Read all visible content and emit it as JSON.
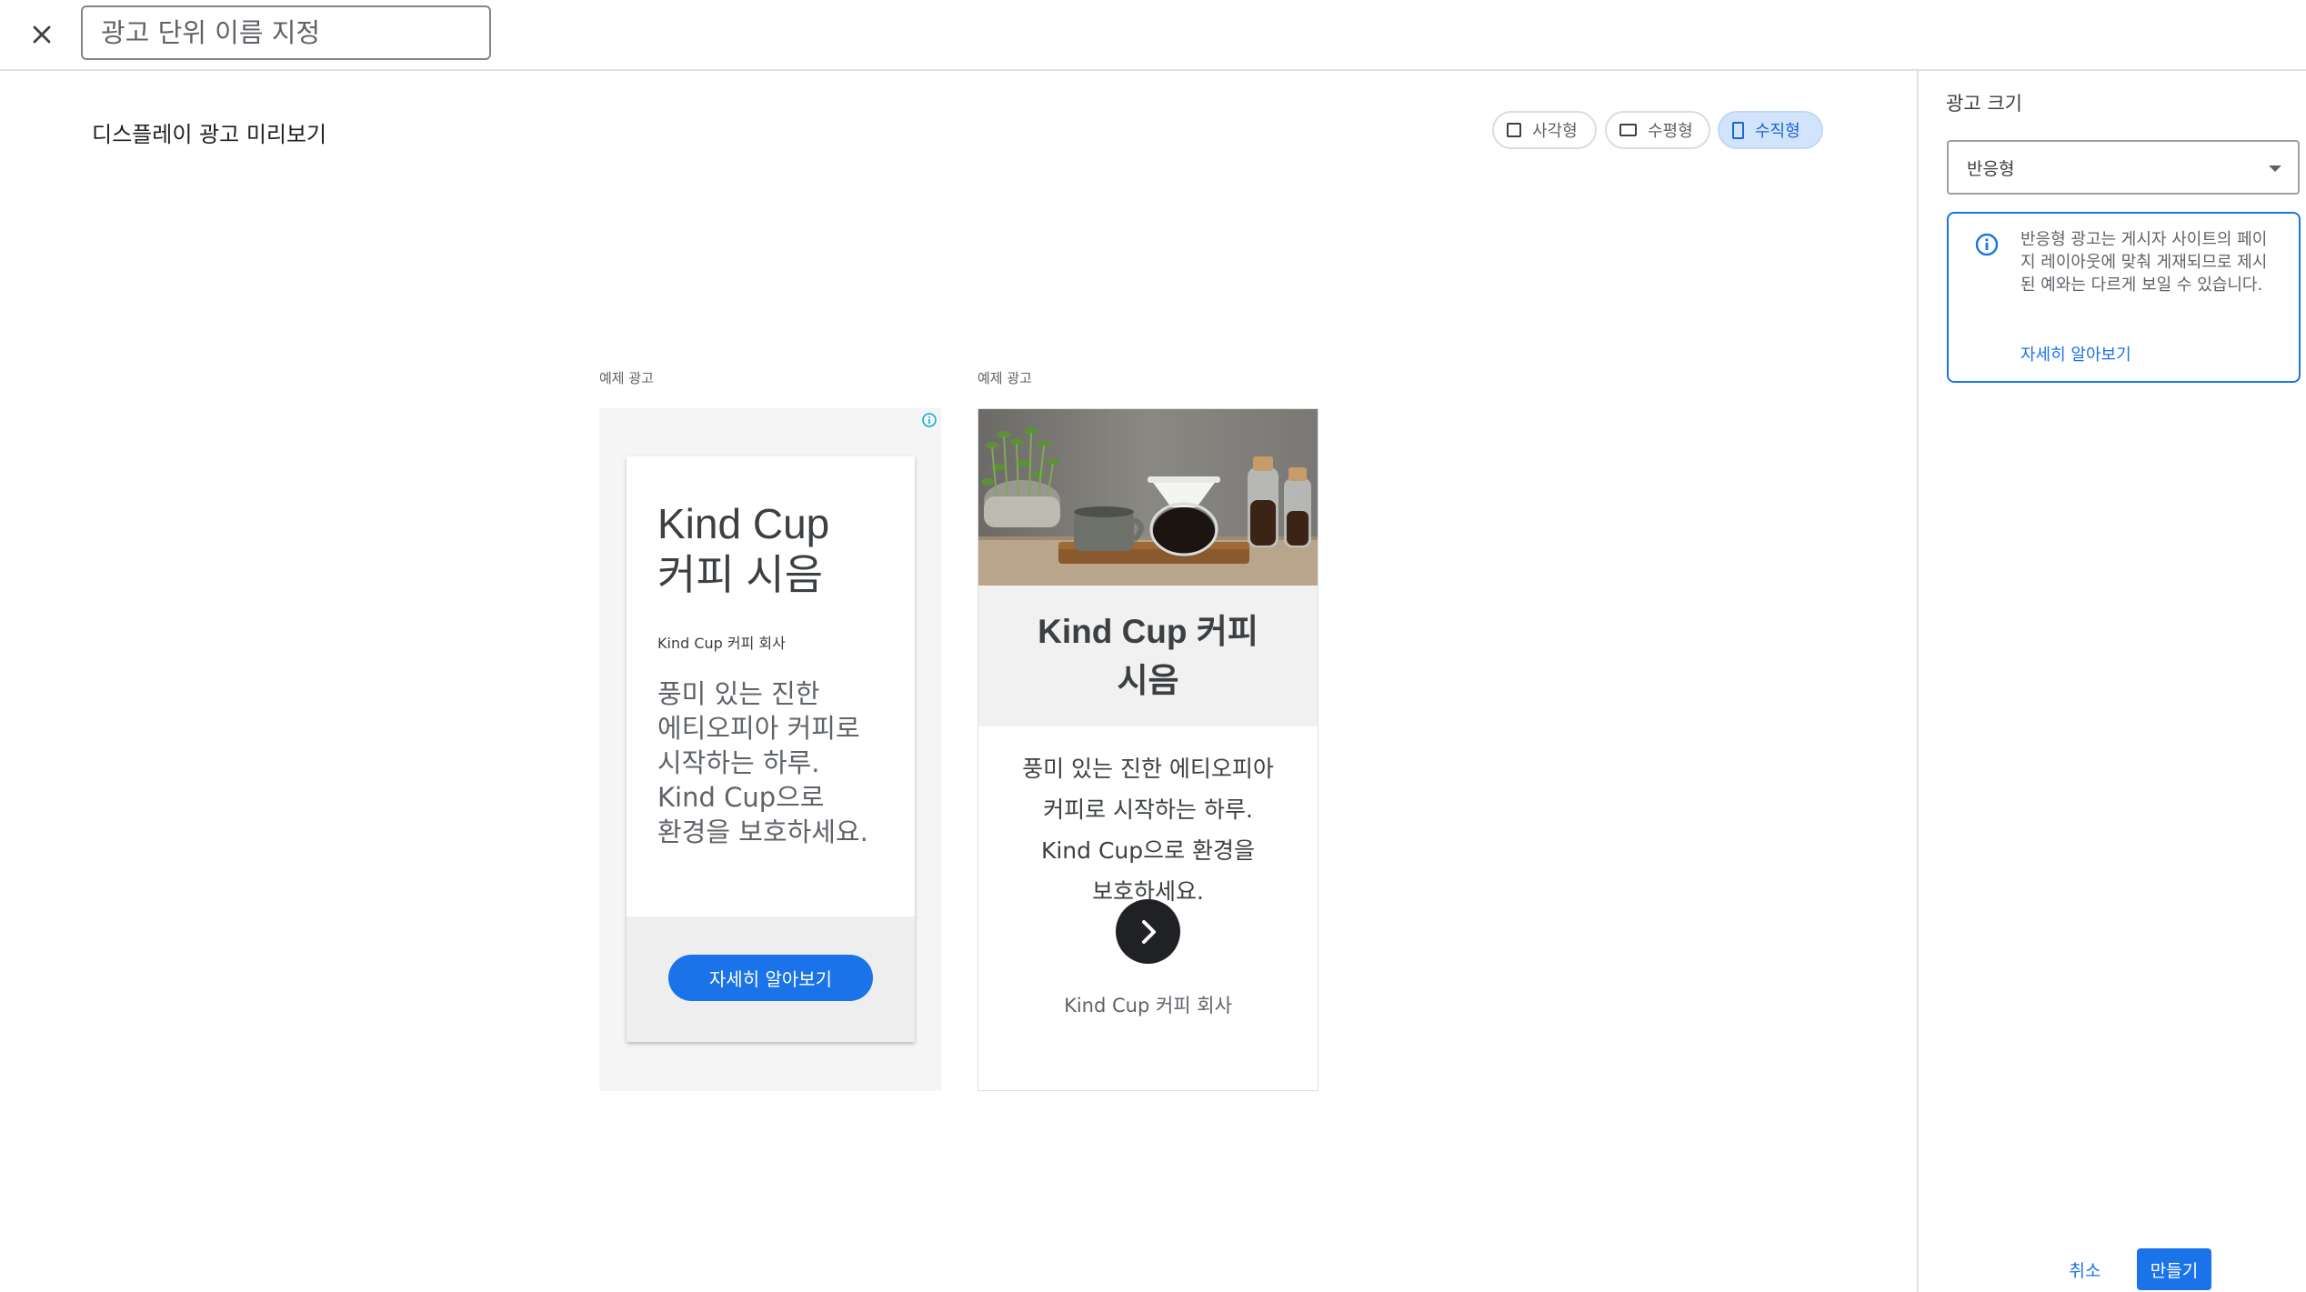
{
  "topbar": {
    "close_icon": "close-icon",
    "ad_unit_name_placeholder": "광고 단위 이름 지정"
  },
  "preview": {
    "title": "디스플레이 광고 미리보기",
    "shape_options": [
      {
        "label": "사각형",
        "icon": "square-icon",
        "selected": false
      },
      {
        "label": "수평형",
        "icon": "horizontal-rect-icon",
        "selected": false
      },
      {
        "label": "수직형",
        "icon": "vertical-rect-icon",
        "selected": true
      }
    ],
    "ads": [
      {
        "label": "예제 광고",
        "headline_line1": "Kind Cup",
        "headline_line2": "커피 시음",
        "advertiser": "Kind Cup 커피 회사",
        "body_lines": [
          "풍미 있는 진한",
          "에티오피아 커피로",
          "시작하는 하루.",
          "Kind Cup으로",
          "환경을 보호하세요."
        ],
        "cta": "자세히 알아보기"
      },
      {
        "label": "예제 광고",
        "headline_line1": "Kind Cup 커피",
        "headline_line2": "시음",
        "body_lines": [
          "풍미 있는 진한 에티오피아",
          "커피로 시작하는 하루.",
          "Kind Cup으로 환경을",
          "보호하세요."
        ],
        "advertiser": "Kind Cup 커피 회사",
        "cta_icon": "chevron-right-icon"
      }
    ]
  },
  "panel": {
    "title": "광고 크기",
    "size_select": {
      "value": "반응형"
    },
    "info": {
      "text": "반응형 광고는 게시자 사이트의 페이지 레이아웃에 맞춰 게재되므로 제시된 예와는 다르게 보일 수 있습니다.",
      "link": "자세히 알아보기"
    },
    "cancel_label": "취소",
    "create_label": "만들기"
  },
  "colors": {
    "accent": "#1a73e8",
    "selected_toggle_bg": "#d2e3fc",
    "dark_button": "#202124"
  }
}
